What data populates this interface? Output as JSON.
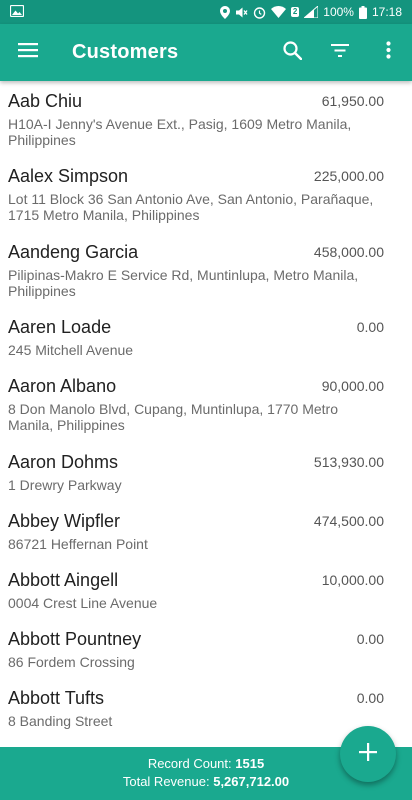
{
  "status_bar": {
    "battery_percent": "100%",
    "time": "17:18",
    "sim_badge": "2"
  },
  "app_bar": {
    "title": "Customers",
    "icons": [
      "menu-icon",
      "search-icon",
      "filter-icon",
      "more-vert-icon"
    ]
  },
  "customers": [
    {
      "name": "Aab Chiu",
      "amount": "61,950.00",
      "address": "H10A-I Jenny's Avenue Ext., Pasig, 1609 Metro Manila, Philippines"
    },
    {
      "name": "Aalex Simpson",
      "amount": "225,000.00",
      "address": "Lot 11 Block 36 San Antonio Ave, San Antonio, Parañaque, 1715 Metro Manila, Philippines"
    },
    {
      "name": "Aandeng Garcia",
      "amount": "458,000.00",
      "address": "Pilipinas-Makro E Service Rd, Muntinlupa, Metro Manila, Philippines"
    },
    {
      "name": "Aaren Loade",
      "amount": "0.00",
      "address": "245 Mitchell Avenue"
    },
    {
      "name": "Aaron Albano",
      "amount": "90,000.00",
      "address": "8 Don Manolo Blvd, Cupang, Muntinlupa, 1770 Metro Manila, Philippines"
    },
    {
      "name": "Aaron Dohms",
      "amount": "513,930.00",
      "address": "1 Drewry Parkway"
    },
    {
      "name": "Abbey Wipfler",
      "amount": "474,500.00",
      "address": "86721 Heffernan Point"
    },
    {
      "name": "Abbott Aingell",
      "amount": "10,000.00",
      "address": "0004 Crest Line Avenue"
    },
    {
      "name": "Abbott Pountney",
      "amount": "0.00",
      "address": "86 Fordem Crossing"
    },
    {
      "name": "Abbott Tufts",
      "amount": "0.00",
      "address": "8 Banding Street"
    }
  ],
  "footer": {
    "record_count_label": "Record Count:",
    "record_count": "1515",
    "total_revenue_label": "Total Revenue:",
    "total_revenue": "5,267,712.00"
  },
  "fab": {
    "icon": "plus-icon"
  },
  "colors": {
    "primary": "#1aa98f",
    "status_bar": "#14947e"
  }
}
